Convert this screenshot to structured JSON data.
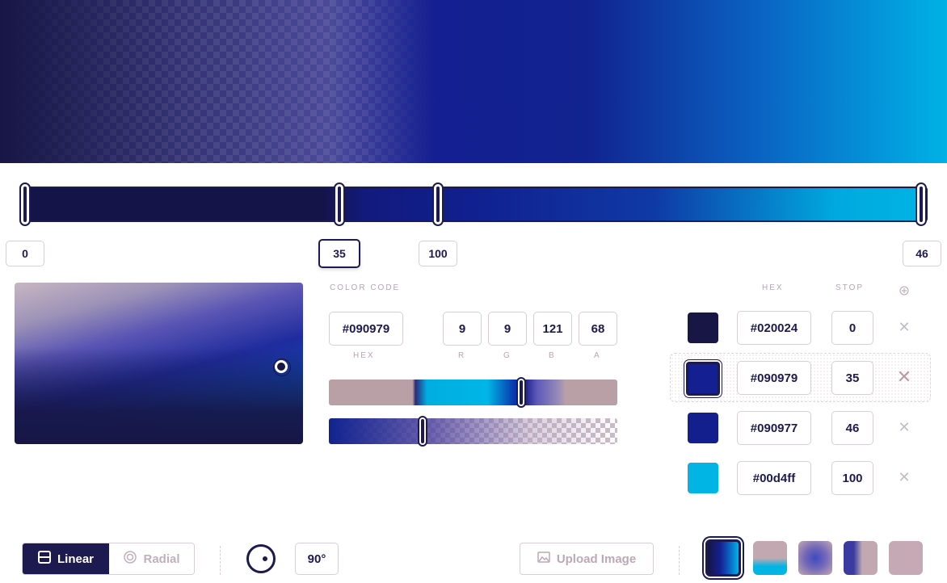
{
  "track": {
    "stop_labels": [
      "0",
      "35",
      "100",
      "46"
    ]
  },
  "color_code": {
    "caption": "COLOR CODE",
    "hex": "#090979",
    "r": "9",
    "g": "9",
    "b": "121",
    "a": "68",
    "hex_label": "HEX",
    "r_label": "R",
    "g_label": "G",
    "b_label": "B",
    "a_label": "A"
  },
  "stops_table": {
    "header_hex": "HEX",
    "header_stop": "STOP",
    "rows": [
      {
        "color": "#171645",
        "hex": "#020024",
        "stop": "0",
        "delete": "✕"
      },
      {
        "color": "#141f91",
        "hex": "#090979",
        "stop": "35",
        "delete": "✕"
      },
      {
        "color": "#131f8c",
        "hex": "#090977",
        "stop": "46",
        "delete": "✕"
      },
      {
        "color": "#00b4e4",
        "hex": "#00d4ff",
        "stop": "100",
        "delete": "✕"
      }
    ]
  },
  "toolbar": {
    "linear_label": "Linear",
    "radial_label": "Radial",
    "angle": "90°",
    "upload_label": "Upload Image"
  },
  "colors": {
    "accent": "#1d1a4f",
    "muted": "#b7a6b1"
  }
}
